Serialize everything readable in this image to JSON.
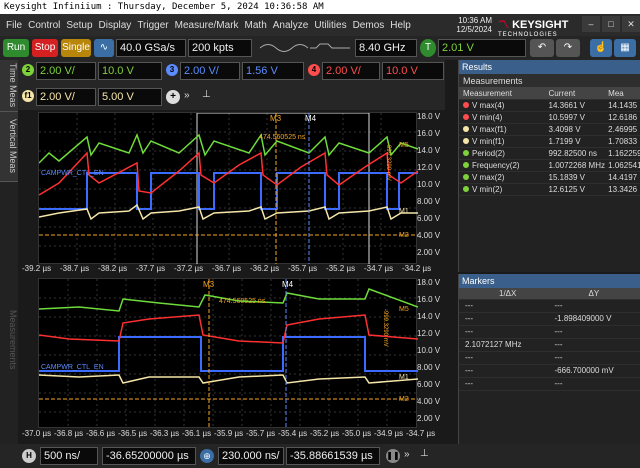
{
  "titlebar": "Keysight Infiniium : Thursday, December 5, 2024 10:36:58 AM",
  "menu": [
    "File",
    "Control",
    "Setup",
    "Display",
    "Trigger",
    "Measure/Mark",
    "Math",
    "Analyze",
    "Utilities",
    "Demos",
    "Help"
  ],
  "clock": {
    "time": "10:36 AM",
    "date": "12/5/2024"
  },
  "logo": {
    "name": "KEYSIGHT",
    "sub": "TECHNOLOGIES"
  },
  "toolbar": {
    "run": "Run",
    "stop": "Stop",
    "single": "Single",
    "sample_rate": "40.0 GSa/s",
    "memory": "200 kpts",
    "bandwidth": "8.40 GHz",
    "trigger_level": "2.01 V"
  },
  "side_tabs": [
    "Time Meas",
    "Vertical Meas",
    "Measurements"
  ],
  "channels": [
    {
      "num": "2",
      "scale": "2.00 V/",
      "offset": "10.0 V",
      "color": "#7fd13b"
    },
    {
      "num": "3",
      "scale": "2.00 V/",
      "offset": "1.56 V",
      "color": "#5b8cff"
    },
    {
      "num": "4",
      "scale": "2.00 V/",
      "offset": "10.0 V",
      "color": "#ff4d4d"
    },
    {
      "num": "f1",
      "scale": "2.00 V/",
      "offset": "5.00 V",
      "color": "#f5e6a8"
    }
  ],
  "plot_top": {
    "yticks": [
      "18.0 V",
      "16.0 V",
      "14.0 V",
      "12.0 V",
      "10.0 V",
      "8.00 V",
      "6.00 V",
      "4.00 V",
      "2.00 V"
    ],
    "xticks": [
      "-39.2 µs",
      "-38.7 µs",
      "-38.2 µs",
      "-37.7 µs",
      "-37.2 µs",
      "-36.7 µs",
      "-36.2 µs",
      "-35.7 µs",
      "-35.2 µs",
      "-34.7 µs",
      "-34.2 µs"
    ],
    "delta": "474.560525 ns",
    "vdelta": "-999.3290 mV",
    "vdelta2": "1.0000000 µV",
    "m3": "M3",
    "m4": "M4",
    "m5": "M5",
    "m6": "M6",
    "m1": "M1",
    "m2": "M2",
    "label": "CAMPWR_CTL_EN"
  },
  "plot_bottom": {
    "yticks": [
      "18.0 V",
      "16.0 V",
      "14.0 V",
      "12.0 V",
      "10.0 V",
      "8.00 V",
      "6.00 V",
      "4.00 V",
      "2.00 V"
    ],
    "xticks": [
      "-37.0 µs",
      "-36.8 µs",
      "-36.6 µs",
      "-36.5 µs",
      "-36.3 µs",
      "-36.1 µs",
      "-35.9 µs",
      "-35.7 µs",
      "-35.4 µs",
      "-35.2 µs",
      "-35.0 µs",
      "-34.9 µs",
      "-34.7 µs"
    ],
    "delta": "474.560525 ns",
    "vdelta": "-999.3290 mV",
    "vdelta2": "1.0000000 µV",
    "m3": "M3",
    "m4": "M4",
    "m5": "M5",
    "m6": "M6",
    "m1": "M1",
    "m2": "M2",
    "label": "CAMPWR_CTL_EN"
  },
  "results": {
    "title": "Results",
    "tab": "Measurements",
    "headers": [
      "Measurement",
      "Current",
      "Mea"
    ],
    "rows": [
      {
        "name": "V max(4)",
        "cur": "14.3661 V",
        "mean": "14.1435",
        "color": "#ff4d4d"
      },
      {
        "name": "V min(4)",
        "cur": "10.5997 V",
        "mean": "12.6186",
        "color": "#ff4d4d"
      },
      {
        "name": "V max(f1)",
        "cur": "3.4098 V",
        "mean": "2.46995",
        "color": "#f5e6a8"
      },
      {
        "name": "V min(f1)",
        "cur": "1.7199 V",
        "mean": "1.70833",
        "color": "#f5e6a8"
      },
      {
        "name": "Period(2)",
        "cur": "992.82500 ns",
        "mean": "1.162259",
        "color": "#7fd13b"
      },
      {
        "name": "Frequency(2)",
        "cur": "1.0072268 MHz",
        "mean": "1.062541",
        "color": "#7fd13b"
      },
      {
        "name": "V max(2)",
        "cur": "15.1839 V",
        "mean": "14.4197",
        "color": "#7fd13b"
      },
      {
        "name": "V min(2)",
        "cur": "12.6125 V",
        "mean": "13.3426",
        "color": "#7fd13b"
      }
    ]
  },
  "markers": {
    "title": "Markers",
    "headers": [
      "1/ΔX",
      "ΔY"
    ],
    "rows": [
      {
        "a": "---",
        "b": "---"
      },
      {
        "a": "---",
        "b": "-1.898409000 V"
      },
      {
        "a": "---",
        "b": "---"
      },
      {
        "a": "2.1072127 MHz",
        "b": "---"
      },
      {
        "a": "---",
        "b": "---"
      },
      {
        "a": "---",
        "b": "-666.700000 mV"
      },
      {
        "a": "---",
        "b": "---"
      }
    ]
  },
  "bottom": {
    "hscale": "500 ns/",
    "hpos": "-36.65200000 µs",
    "zoom_scale": "230.000 ns/",
    "zoom_pos": "-35.88661539 µs"
  }
}
